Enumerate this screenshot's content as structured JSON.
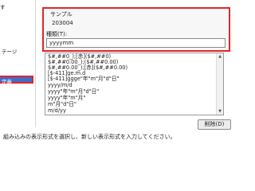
{
  "left_panel": {
    "item_top": "す",
    "item_mid": "テージ",
    "item_selected": "定義"
  },
  "sample": {
    "label": "サンプル",
    "value": "203004"
  },
  "type_field": {
    "label": "種類(T):",
    "value": "yyyymm"
  },
  "format_list": {
    "items": [
      "$#,##0_);[赤]($#,##0)",
      "$#,##0.00_);($#,##0.00)",
      "$#,##0.00_);[赤]($#,##0.00)",
      "[$-411]ge.m.d",
      "[$-411]ggge\"年\"m\"月\"d\"日\"",
      "yyyy/m/d",
      "yyyy\"年\"m\"月\"d\"日\"",
      "yyyy\"年\"m\"月\"",
      "m\"月\"d\"日\"",
      "m/d/yy"
    ]
  },
  "buttons": {
    "delete": "削除(D)"
  },
  "hint_text": "組み込みの表示形式を選択し、新しい表示形式を入力してください。"
}
